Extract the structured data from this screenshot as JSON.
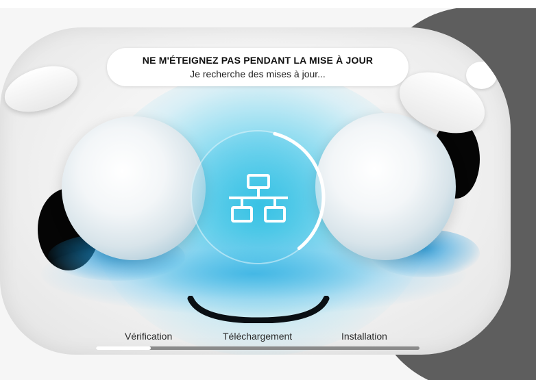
{
  "header": {
    "title": "NE M'ÉTEIGNEZ PAS PENDANT LA MISE À JOUR",
    "status": "Je recherche des mises à jour..."
  },
  "center": {
    "icon": "network-icon",
    "spinner_progress": 0.35
  },
  "steps": [
    {
      "label": "Vérification"
    },
    {
      "label": "Téléchargement"
    },
    {
      "label": "Installation"
    }
  ],
  "progress": {
    "value": 0.17
  },
  "colors": {
    "accent": "#2bbee1",
    "ears": "#050505",
    "backdrop": "#5e5e5e",
    "track": "#8a8a8a",
    "fill": "#ffffff"
  }
}
